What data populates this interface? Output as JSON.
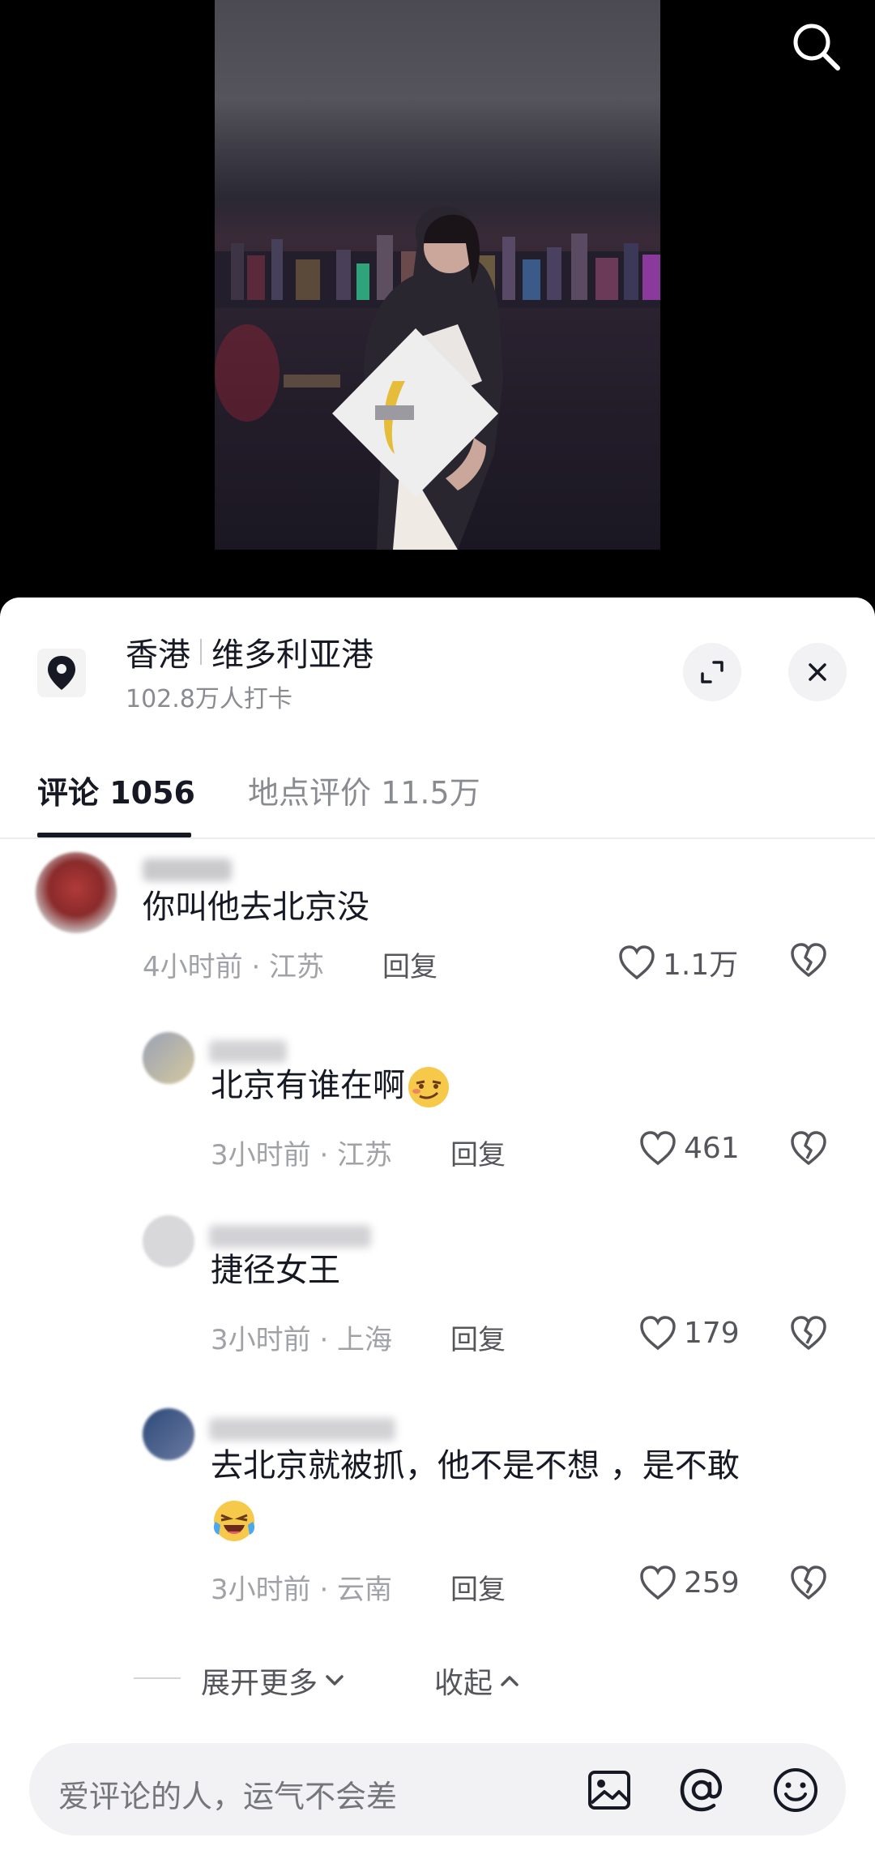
{
  "location": {
    "city": "香港",
    "place": "维多利亚港",
    "checkins": "102.8万人打卡"
  },
  "tabs": [
    {
      "label": "评论 1056",
      "active": true
    },
    {
      "label": "地点评价 11.5万",
      "active": false
    }
  ],
  "comments": [
    {
      "text": "你叫他去北京没",
      "time": "4小时前 · 江苏",
      "reply": "回复",
      "likes": "1.1万",
      "emoji": false
    },
    {
      "text": "北京有谁在啊",
      "time": "3小时前 · 江苏",
      "reply": "回复",
      "likes": "461",
      "emoji": true
    },
    {
      "text": "捷径女王",
      "time": "3小时前 · 上海",
      "reply": "回复",
      "likes": "179",
      "emoji": false
    },
    {
      "text": "去北京就被抓，他不是不想 ，是不敢",
      "time": "3小时前 · 云南",
      "reply": "回复",
      "likes": "259",
      "emoji": true
    }
  ],
  "actions": {
    "expand_more": "展开更多",
    "collapse": "收起"
  },
  "input": {
    "placeholder": "爱评论的人，运气不会差"
  },
  "colors": {
    "text_primary": "#161823",
    "text_secondary": "#a1a2a7",
    "sheet_bg": "#ffffff",
    "input_bg": "#f2f2f4"
  }
}
